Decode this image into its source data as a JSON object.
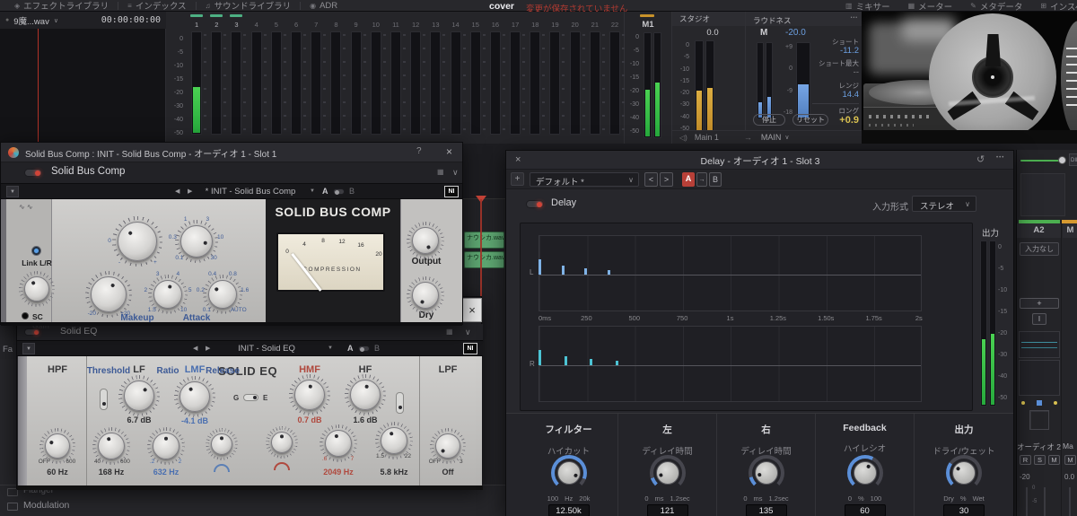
{
  "colors": {
    "accent_red": "#c84438",
    "meter_green": "#3ec24e",
    "meter_orange": "#cf9a30",
    "loudness_blue": "#6c9fe0",
    "value_yellow": "#d8c050",
    "tap_blue": "#7fb2e6",
    "tap_cyan": "#4cc3d4"
  },
  "toolbar": {
    "left_items": [
      {
        "name": "effects-library",
        "icon": "effects-library-icon",
        "glyph": "◈",
        "label": "エフェクトライブラリ"
      },
      {
        "name": "index",
        "icon": "index-icon",
        "glyph": "≡",
        "label": "インデックス"
      },
      {
        "name": "sound-library",
        "icon": "sound-library-icon",
        "glyph": "♫",
        "label": "サウンドライブラリ"
      },
      {
        "name": "adr",
        "icon": "adr-icon",
        "glyph": "◉",
        "label": "ADR"
      }
    ],
    "project_title": "cover",
    "unsaved_message": "変更が保存されていません",
    "right_items": [
      {
        "name": "mixer",
        "icon": "mixer-icon",
        "glyph": "▥",
        "label": "ミキサー"
      },
      {
        "name": "meter",
        "icon": "meter-icon",
        "glyph": "▦",
        "label": "メーター"
      },
      {
        "name": "metadata",
        "icon": "metadata-icon",
        "glyph": "✎",
        "label": "メタデータ"
      },
      {
        "name": "inspector",
        "icon": "inspector-icon",
        "glyph": "⊞",
        "label": "インスペ"
      }
    ]
  },
  "player": {
    "clip_name": "9魔...wav",
    "timecode": "00:00:00:00"
  },
  "meter_bridge": {
    "channel_count": 22,
    "active_channels": 3,
    "scale": [
      "0",
      "-5",
      "-10",
      "-15",
      "-20",
      "-30",
      "-40",
      "-50"
    ]
  },
  "m1_meter": {
    "label": "M1",
    "scale": [
      "0",
      "-5",
      "-10",
      "-15",
      "-20",
      "-30",
      "-40",
      "-50"
    ]
  },
  "studio_panel": {
    "title": "スタジオ",
    "value": "0.0",
    "scale": [
      "0",
      "-5",
      "-10",
      "-15",
      "-20",
      "-30",
      "-40",
      "-50"
    ]
  },
  "loudness_panel": {
    "title": "ラウドネス",
    "menu_icon": "•••",
    "m_label": "M",
    "m_value": "-20.0",
    "scale": [
      "+9",
      "0",
      "-9",
      "-18"
    ],
    "stats": [
      {
        "label": "ショート",
        "value": "-11.2",
        "color": "#6c9fe0"
      },
      {
        "label": "ショート最大",
        "value": "--",
        "color": "#85858b"
      },
      {
        "label": "レンジ",
        "value": "14.4",
        "color": "#6c9fe0"
      },
      {
        "label": "ロング",
        "value": "+0.9",
        "color": "#d8c050"
      }
    ],
    "stop_label": "停止",
    "reset_label": "リセット"
  },
  "monitor_row": {
    "source": "Main 1",
    "arrow": "→",
    "dest": "MAIN"
  },
  "bus_comp_window": {
    "title": "Solid Bus Comp : INIT - Solid Bus Comp - オーディオ 1 - Slot 1",
    "help": "?",
    "close": "×",
    "plugin_name": "Solid Bus Comp",
    "preset": "* INIT - Solid Bus Comp",
    "a_label": "A",
    "b_label": "B",
    "link_label": "Link L/R",
    "sc_gain_label": "SC Gain",
    "makeup_label": "Makeup",
    "attack_label": "Attack",
    "threshold_label": "Threshold",
    "ratio_label": "Ratio",
    "release_label": "Release",
    "output_label": "Output",
    "dry_label": "Dry",
    "makeup_marks": [
      "0",
      "-",
      "+"
    ],
    "attack_marks": [
      "0.1",
      "0.3",
      "1",
      "3",
      "10",
      "30"
    ],
    "threshold_marks": [
      "-20",
      "+20"
    ],
    "ratio_marks": [
      "1.5",
      "2",
      "3",
      "4",
      "5",
      "10"
    ],
    "release_marks": [
      "0.1",
      "0.2",
      "0.4",
      "0.8",
      "1.6",
      "AUTO"
    ],
    "brand_title": "SOLID BUS COMP",
    "vu_scale": [
      "0",
      "4",
      "8",
      "12",
      "16",
      "20"
    ],
    "vu_label": "COMPRESSION"
  },
  "solid_eq_window": {
    "close": "×",
    "plugin_name": "Solid EQ",
    "preset": "INIT - Solid EQ",
    "a_label": "A",
    "b_label": "B",
    "title": "SOLID EQ",
    "g_label": "G",
    "e_label": "E",
    "hpf_name": "HPF",
    "hpf_value": "60 Hz",
    "hpf_marks": [
      "OFF",
      "600"
    ],
    "lf_name": "LF",
    "lf_gain": "6.7 dB",
    "lf_freq": "168 Hz",
    "lf_marks": [
      "40",
      "600"
    ],
    "lmf_name": "LMF",
    "lmf_gain": "-4.1 dB",
    "lmf_freq": "632 Hz",
    "lmf_marks": [
      ".2",
      "2"
    ],
    "hmf_name": "HMF",
    "hmf_gain": "0.7 dB",
    "hmf_freq": "2049 Hz",
    "hmf_marks": [
      ".6",
      "7"
    ],
    "hf_name": "HF",
    "hf_gain": "1.6 dB",
    "hf_freq": "5.8 kHz",
    "hf_marks": [
      "1.5",
      "22"
    ],
    "lpf_name": "LPF",
    "lpf_value": "Off",
    "lpf_marks": [
      "OFF",
      "3"
    ]
  },
  "effects_panel": {
    "header_fragment": "Fa",
    "items": [
      {
        "label": "Flanger"
      },
      {
        "label": "Modulation"
      }
    ]
  },
  "timeline": {
    "clip1": "ナウシカ.wav",
    "clip2": "ナウシカ.wav"
  },
  "delay_window": {
    "title": "Delay - オーディオ 1 - Slot 3",
    "close": "×",
    "history_icon": "↺",
    "menu_icon": "•••",
    "add_preset": "+",
    "preset": "デフォルト *",
    "prev": "<",
    "next": ">",
    "a_label": "A",
    "ab_arrow": "→",
    "b_label": "B",
    "plugin_name": "Delay",
    "input_format_label": "入力形式",
    "input_format_value": "ステレオ",
    "graph": {
      "l_label": "L",
      "r_label": "R",
      "time_labels": [
        "0ms",
        "250",
        "500",
        "750",
        "1s",
        "1.25s",
        "1.50s",
        "1.75s",
        "2s"
      ],
      "t_max_ms": 2000,
      "taps_l_ms": [
        0,
        121,
        242,
        363
      ],
      "taps_r_ms": [
        0,
        135,
        270,
        405
      ],
      "tap_heights": [
        17,
        10,
        7,
        5
      ]
    },
    "output_label": "出力",
    "output_scale": [
      "0",
      "-5",
      "-10",
      "-15",
      "-20",
      "-30",
      "-40",
      "-50"
    ],
    "controls": [
      {
        "name": "filter",
        "group": "フィルター",
        "param": "ハイカット",
        "min": "100",
        "unit": "Hz",
        "max": "20k",
        "value": "12.50k",
        "frac": 0.91
      },
      {
        "name": "left-delay-time",
        "group": "左",
        "param": "ディレイ時間",
        "min": "0",
        "unit": "ms",
        "max": "1.2sec",
        "value": "121",
        "frac": 0.1
      },
      {
        "name": "right-delay-time",
        "group": "右",
        "param": "ディレイ時間",
        "min": "0",
        "unit": "ms",
        "max": "1.2sec",
        "value": "135",
        "frac": 0.11
      },
      {
        "name": "feedback",
        "group": "Feedback",
        "param": "ハイレシオ",
        "min": "0",
        "unit": "%",
        "max": "100",
        "value": "60",
        "frac": 0.6
      },
      {
        "name": "output-mix",
        "group": "出力",
        "param": "ドライ/ウェット",
        "min": "Dry",
        "unit": "%",
        "max": "Wet",
        "value": "30",
        "frac": 0.3
      }
    ]
  },
  "mixer": {
    "dim_label": "DIM",
    "strip_a2": {
      "header": "A2",
      "input": "入力なし",
      "add_label": "+",
      "insert_label": "I",
      "name": "オーディオ 2",
      "solo_buttons": [
        "R",
        "S",
        "M"
      ],
      "value": "-20",
      "fader_ticks": [
        "0",
        "-5"
      ]
    },
    "strip_main": {
      "header": "M",
      "name": "Ma",
      "mute_label": "M",
      "value": "0.0"
    }
  }
}
